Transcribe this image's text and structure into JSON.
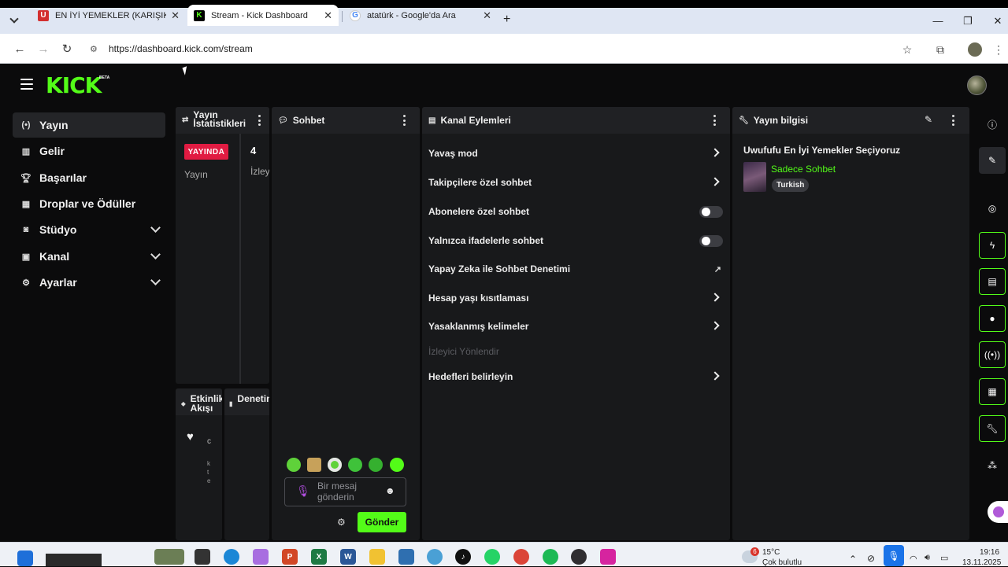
{
  "browser": {
    "tabs": [
      {
        "title": "EN İYİ YEMEKLER (KARIŞIK) @m",
        "favicon": "U"
      },
      {
        "title": "Stream - Kick Dashboard",
        "favicon": "K"
      },
      {
        "title": "atatürk - Google'da Ara",
        "favicon": "G"
      }
    ],
    "url": "https://dashboard.kick.com/stream"
  },
  "kick": {
    "logo": "KICK",
    "logo_badge": "BETA"
  },
  "nav": {
    "items": [
      {
        "label": "Yayın",
        "icon": "broadcast-icon"
      },
      {
        "label": "Gelir",
        "icon": "bar-chart-icon"
      },
      {
        "label": "Başarılar",
        "icon": "trophy-icon"
      },
      {
        "label": "Droplar ve Ödüller",
        "icon": "gift-icon"
      },
      {
        "label": "Stüdyo",
        "icon": "studio-icon"
      },
      {
        "label": "Kanal",
        "icon": "person-icon"
      },
      {
        "label": "Ayarlar",
        "icon": "gear-icon"
      }
    ]
  },
  "stats": {
    "title": "Yayın İstatistikleri",
    "live": "YAYINDA",
    "label": "Yayın",
    "count": "4",
    "viewers": "İzley"
  },
  "activity": {
    "title": "Etkinlik Akışı",
    "chars": [
      "c",
      "k",
      "t",
      "e"
    ]
  },
  "moderation": {
    "title": "Denetim Eylemleri"
  },
  "chat": {
    "title": "Sohbet",
    "placeholder": "Bir mesaj gönderin",
    "send": "Gönder"
  },
  "actions": {
    "title": "Kanal Eylemleri",
    "rows": [
      "Yavaş mod",
      "Takipçilere özel sohbet",
      "Abonelere özel sohbet",
      "Yalnızca ifadelerle sohbet",
      "Yapay Zeka ile Sohbet Denetimi",
      "Hesap yaşı kısıtlaması",
      "Yasaklanmış kelimeler",
      "İzleyici Yönlendir",
      "Hedefleri belirleyin"
    ]
  },
  "info": {
    "title": "Yayın bilgisi",
    "stream_title": "Uwufufu En İyi Yemekler Seçiyoruz",
    "category": "Sadece Sohbet",
    "language": "Turkish"
  },
  "taskbar": {
    "weather_temp": "15°C",
    "weather_desc": "Çok bulutlu",
    "weather_badge": "6",
    "time": "19:16",
    "date": "13.11.2025"
  }
}
